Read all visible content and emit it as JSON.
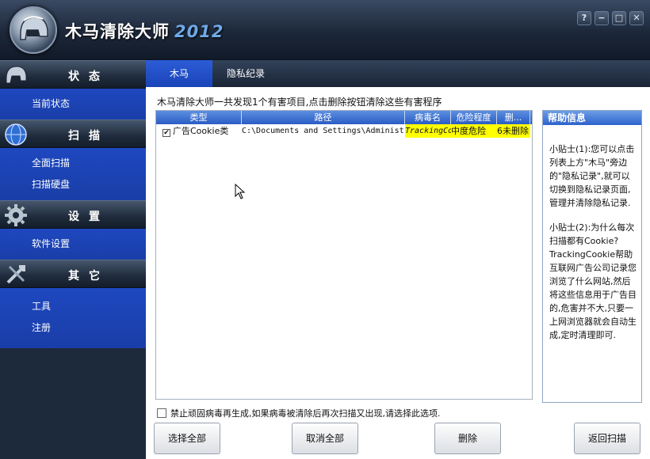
{
  "window": {
    "title": "木马清除大师",
    "year": "2012",
    "buttons": {
      "help": "?",
      "minimize": "−",
      "maximize": "□",
      "close": "✕"
    }
  },
  "sidebar": {
    "sections": [
      {
        "label": "状态",
        "icon": "helmet-icon",
        "items": [
          "当前状态"
        ]
      },
      {
        "label": "扫描",
        "icon": "globe-icon",
        "items": [
          "全面扫描",
          "扫描硬盘"
        ]
      },
      {
        "label": "设置",
        "icon": "gear-icon",
        "items": [
          "软件设置"
        ]
      },
      {
        "label": "其它",
        "icon": "tools-icon",
        "items": [
          "工具",
          "注册"
        ]
      }
    ]
  },
  "tabs": [
    {
      "label": "木马",
      "active": true
    },
    {
      "label": "隐私纪录",
      "active": false
    }
  ],
  "summary": "木马清除大师一共发现1个有害项目,点击删除按钮清除这些有害程序",
  "table": {
    "columns": [
      "类型",
      "路径",
      "病毒名",
      "危险程度",
      "删..."
    ],
    "rows": [
      {
        "checked": true,
        "type": "广告Cookie类",
        "path": "C:\\Documents and Settings\\Administ",
        "virus": "TrackingCo",
        "risk": "中度危险",
        "del": "6未删除"
      }
    ]
  },
  "help": {
    "title": "帮助信息",
    "tip1": "小贴士(1):您可以点击列表上方\"木马\"旁边的\"隐私记录\",就可以切换到隐私记录页面,管理并清除隐私记录.",
    "tip2": "小贴士(2):为什么每次扫描都有Cookie? TrackingCookie帮助互联网广告公司记录您浏览了什么网站,然后将这些信息用于广告目的,危害并不大,只要一上网浏览器就会自动生成,定时清理即可."
  },
  "option_text": "禁止顽固病毒再生成,如果病毒被清除后再次扫描又出现,请选择此选项.",
  "buttons": {
    "select_all": "选择全部",
    "deselect_all": "取消全部",
    "delete": "删除",
    "back_scan": "返回扫描"
  },
  "colors": {
    "accent": "#1e48c0",
    "highlight": "#ffff00",
    "header": "#2a5cc4"
  }
}
